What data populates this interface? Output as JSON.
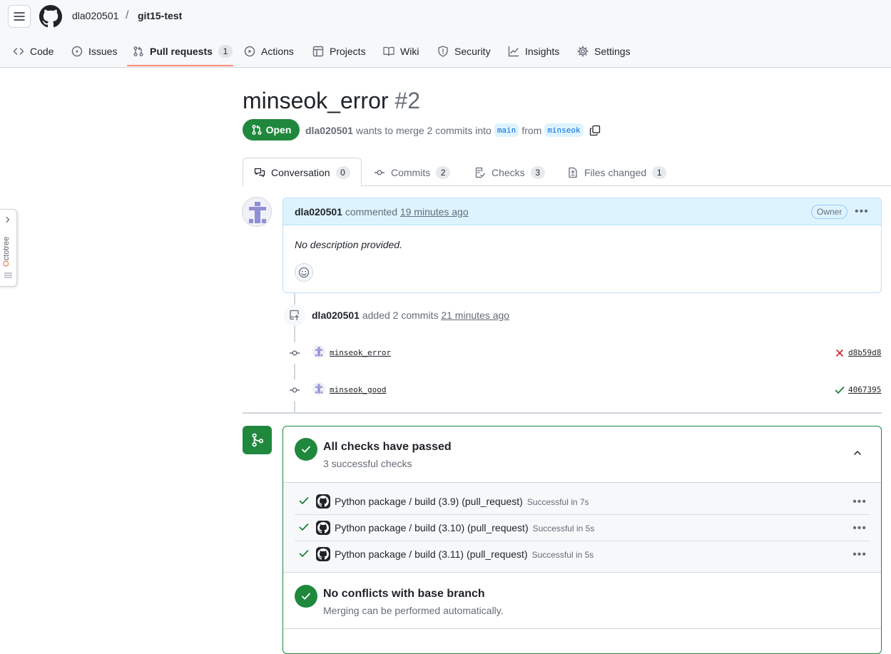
{
  "repo": {
    "owner": "dla020501",
    "separator": "/",
    "name": "git15-test"
  },
  "nav": {
    "code": "Code",
    "issues": "Issues",
    "pull_requests": "Pull requests",
    "pull_requests_count": "1",
    "actions": "Actions",
    "projects": "Projects",
    "wiki": "Wiki",
    "security": "Security",
    "insights": "Insights",
    "settings": "Settings"
  },
  "octotree": {
    "label_prefix": "O",
    "label_rest": "ctotree"
  },
  "pr": {
    "title": "minseok_error",
    "number": "#2",
    "state": "Open",
    "author": "dla020501",
    "merge_text": "wants to merge 2 commits into",
    "base_branch": "main",
    "from_text": "from",
    "head_branch": "minseok"
  },
  "tabs": {
    "conversation": "Conversation",
    "conversation_count": "0",
    "commits": "Commits",
    "commits_count": "2",
    "checks": "Checks",
    "checks_count": "3",
    "files_changed": "Files changed",
    "files_changed_count": "1"
  },
  "comment": {
    "author": "dla020501",
    "action": "commented",
    "time": "19 minutes ago",
    "role": "Owner",
    "body": "No description provided."
  },
  "timeline": {
    "event_author": "dla020501",
    "event_text": "added 2 commits",
    "event_time": "21 minutes ago",
    "commits": [
      {
        "message": "minseok_error",
        "sha": "d8b59d8",
        "status": "failure"
      },
      {
        "message": "minseok_good",
        "sha": "4067395",
        "status": "success"
      }
    ]
  },
  "merge_box": {
    "checks_title": "All checks have passed",
    "checks_subtitle": "3 successful checks",
    "checks": [
      {
        "name": "Python package / build (3.9) (pull_request)",
        "status": "Successful in 7s"
      },
      {
        "name": "Python package / build (3.10) (pull_request)",
        "status": "Successful in 5s"
      },
      {
        "name": "Python package / build (3.11) (pull_request)",
        "status": "Successful in 5s"
      }
    ],
    "conflicts_title": "No conflicts with base branch",
    "conflicts_subtitle": "Merging can be performed automatically."
  },
  "colors": {
    "accent_green": "#1f883d",
    "tab_underline": "#fd8c73",
    "link_blue": "#0969da",
    "error_red": "#cf222e"
  }
}
